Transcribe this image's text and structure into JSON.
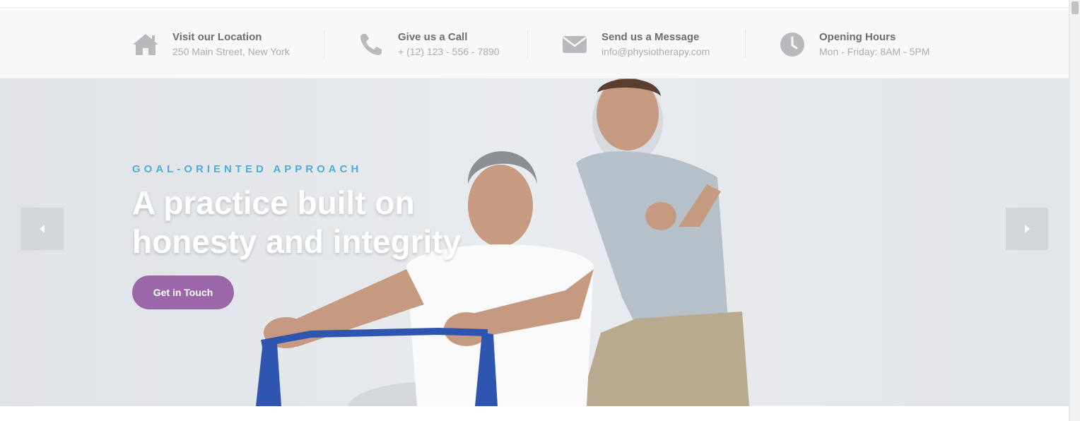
{
  "info_bar": {
    "items": [
      {
        "icon": "home-icon",
        "title": "Visit our Location",
        "subtitle": "250 Main Street, New York"
      },
      {
        "icon": "phone-icon",
        "title": "Give us a Call",
        "subtitle": "+ (12) 123 - 556 - 7890"
      },
      {
        "icon": "envelope-icon",
        "title": "Send us a Message",
        "subtitle": "info@physiotherapy.com"
      },
      {
        "icon": "clock-icon",
        "title": "Opening Hours",
        "subtitle": "Mon - Friday: 8AM - 5PM"
      }
    ]
  },
  "hero": {
    "eyebrow": "GOAL-ORIENTED APPROACH",
    "headline_line1": "A practice built on",
    "headline_line2": "honesty and integrity",
    "cta_label": "Get in Touch",
    "prev_icon": "caret-left-icon",
    "next_icon": "caret-right-icon"
  },
  "colors": {
    "accent_blue": "#4eaed0",
    "button_purple": "#9b67a9",
    "info_bg": "#f7f8f9",
    "icon_gray": "#b7b9bc"
  }
}
